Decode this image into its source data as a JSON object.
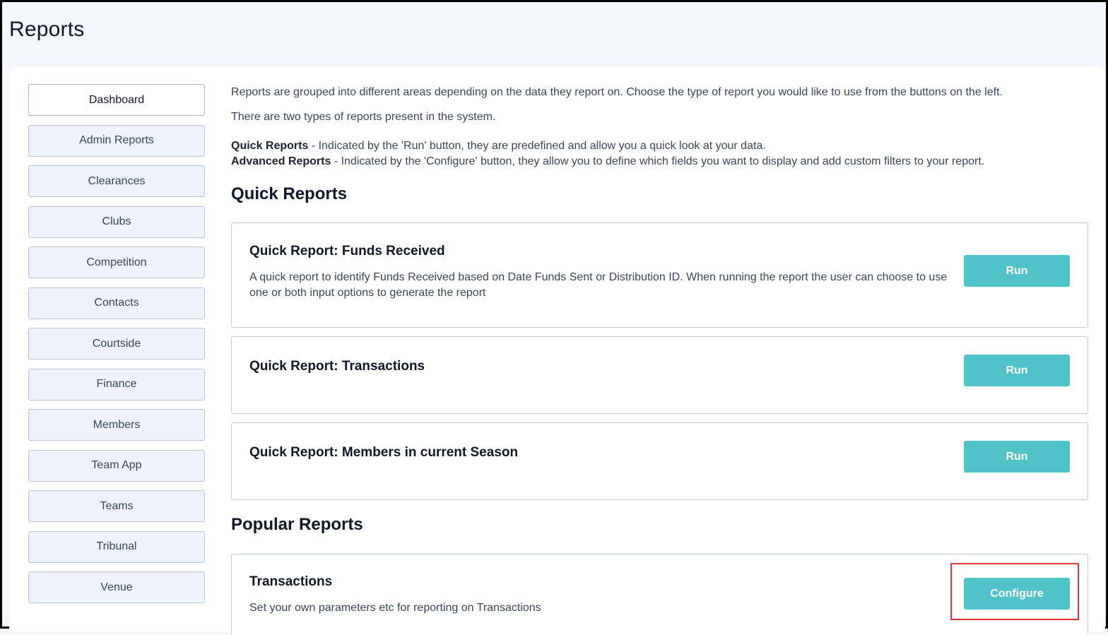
{
  "page": {
    "title": "Reports"
  },
  "sidebar": {
    "items": [
      {
        "label": "Dashboard",
        "active": true
      },
      {
        "label": "Admin Reports"
      },
      {
        "label": "Clearances"
      },
      {
        "label": "Clubs"
      },
      {
        "label": "Competition"
      },
      {
        "label": "Contacts"
      },
      {
        "label": "Courtside"
      },
      {
        "label": "Finance"
      },
      {
        "label": "Members"
      },
      {
        "label": "Team App"
      },
      {
        "label": "Teams"
      },
      {
        "label": "Tribunal"
      },
      {
        "label": "Venue"
      }
    ]
  },
  "intro": {
    "line1": "Reports are grouped into different areas depending on the data they report on. Choose the type of report you would like to use from the buttons on the left.",
    "line2": "There are two types of reports present in the system.",
    "quick_label": "Quick Reports",
    "quick_text": " - Indicated by the 'Run' button, they are predefined and allow you a quick look at your data.",
    "advanced_label": "Advanced Reports",
    "advanced_text": " - Indicated by the 'Configure' button, they allow you to define which fields you want to display and add custom filters to your report."
  },
  "quick_reports": {
    "heading": "Quick Reports",
    "items": [
      {
        "title": "Quick Report: Funds Received",
        "description": "A quick report to identify Funds Received based on Date Funds Sent or Distribution ID. When running the report the user can choose to use one or both input options to generate the report",
        "button": "Run"
      },
      {
        "title": "Quick Report: Transactions",
        "description": "",
        "button": "Run"
      },
      {
        "title": "Quick Report: Members in current Season",
        "description": "",
        "button": "Run"
      }
    ]
  },
  "popular_reports": {
    "heading": "Popular Reports",
    "items": [
      {
        "title": "Transactions",
        "description": "Set your own parameters etc for reporting on Transactions",
        "button": "Configure"
      }
    ]
  },
  "colors": {
    "accent": "#4fc3c8",
    "highlight": "#e0393c",
    "nav_bg": "#eef3fb"
  }
}
